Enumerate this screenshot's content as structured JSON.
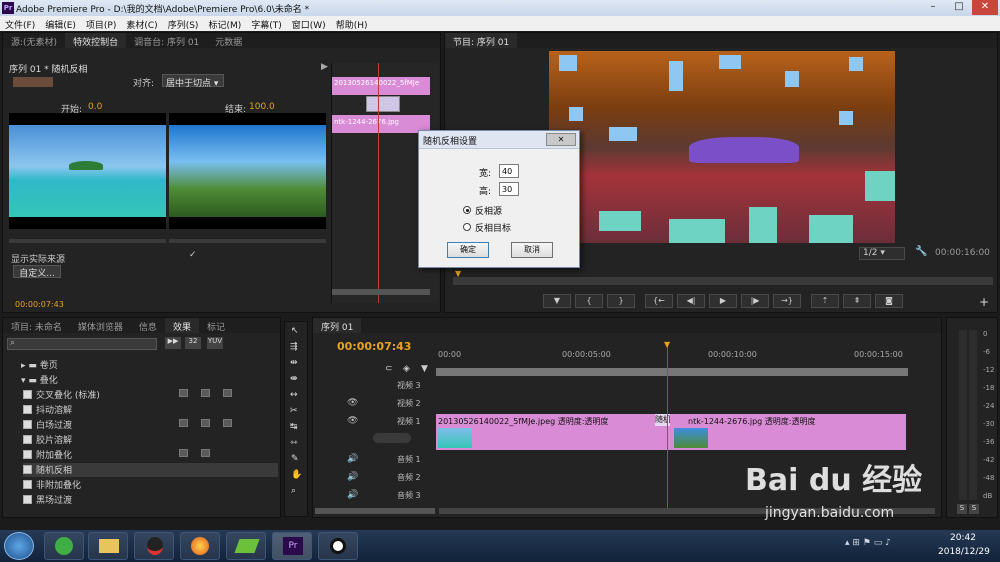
{
  "app": {
    "title": "Adobe Premiere Pro - D:\\我的文档\\Adobe\\Premiere Pro\\6.0\\未命名 *",
    "logo": "Pr"
  },
  "menu": [
    "文件(F)",
    "编辑(E)",
    "项目(P)",
    "素材(C)",
    "序列(S)",
    "标记(M)",
    "字幕(T)",
    "窗口(W)",
    "帮助(H)"
  ],
  "source_panel": {
    "tabs": [
      "源:(无素材)",
      "特效控制台",
      "调音台: 序列 01",
      "元数据"
    ],
    "header": "序列 01 * 随机反相",
    "align_label": "对齐:",
    "align_value": "居中于切点",
    "start_label": "开始:",
    "start_value": "0.0",
    "end_label": "结束:",
    "end_value": "100.0",
    "show_actual": "显示实际来源",
    "custom_button": "自定义...",
    "timecode": "00:00:07:43",
    "mini_clip1": "20130526140022_5fMJe",
    "mini_clip2": "ntk-1244-2676.jpg"
  },
  "program_monitor": {
    "tab": "节目: 序列 01",
    "zoom": "1/2",
    "duration": "00:00:16:00"
  },
  "dialog": {
    "title": "随机反相设置",
    "width_label": "宽:",
    "width_value": "40",
    "height_label": "高:",
    "height_value": "30",
    "option1": "反相源",
    "option2": "反相目标",
    "ok": "确定",
    "cancel": "取消"
  },
  "effects_panel": {
    "tabs": [
      "项目: 未命名",
      "媒体浏览器",
      "信息",
      "效果",
      "标记"
    ],
    "folders": [
      "卷页",
      "叠化"
    ],
    "items": [
      "交叉叠化 (标准)",
      "抖动溶解",
      "白场过渡",
      "胶片溶解",
      "附加叠化",
      "随机反相",
      "非附加叠化",
      "黑场过渡"
    ]
  },
  "timeline": {
    "tab": "序列 01",
    "timecode": "00:00:07:43",
    "ruler": [
      "00:00",
      "00:00:05:00",
      "00:00:10:00",
      "00:00:15:00"
    ],
    "tracks": [
      "视频 3",
      "视频 2",
      "视频 1",
      "音频 1",
      "音频 2",
      "音频 3"
    ],
    "clip1": "20130526140022_5fMJe.jpeg 透明度:透明度",
    "transition": "随机反",
    "clip2": "ntk-1244-2676.jpg 透明度:透明度"
  },
  "meter": [
    "0",
    "-6",
    "-12",
    "-18",
    "-24",
    "-30",
    "-36",
    "-42",
    "-48",
    "dB"
  ],
  "taskbar": {
    "time": "20:42",
    "date": "2018/12/29"
  },
  "watermark": {
    "brand": "Bai du 经验",
    "url": "jingyan.baidu.com"
  }
}
